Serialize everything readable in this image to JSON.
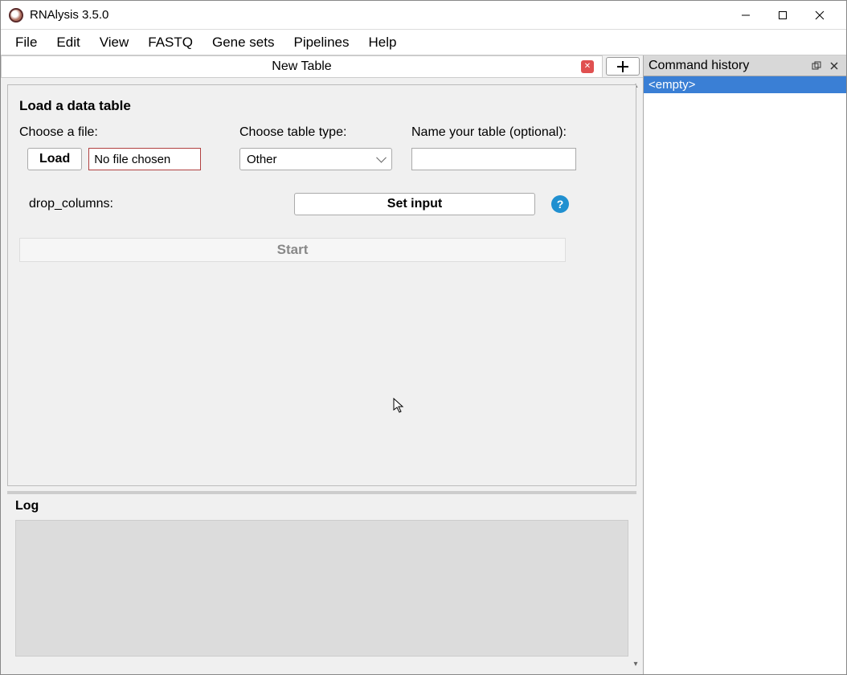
{
  "titlebar": {
    "title": "RNAlysis 3.5.0"
  },
  "menubar": {
    "items": [
      "File",
      "Edit",
      "View",
      "FASTQ",
      "Gene sets",
      "Pipelines",
      "Help"
    ]
  },
  "tabs": {
    "active_label": "New Table",
    "add_tooltip": "Add tab"
  },
  "load_group": {
    "title": "Load a data table",
    "choose_file_label": "Choose a file:",
    "load_button": "Load",
    "file_display": "No file chosen",
    "choose_type_label": "Choose table type:",
    "type_selected": "Other",
    "name_label": "Name your table (optional):",
    "name_value": "",
    "drop_columns_label": "drop_columns:",
    "set_input_button": "Set input",
    "help_text": "?",
    "start_button": "Start"
  },
  "log": {
    "title": "Log"
  },
  "command_history": {
    "title": "Command history",
    "items": [
      "<empty>"
    ]
  }
}
